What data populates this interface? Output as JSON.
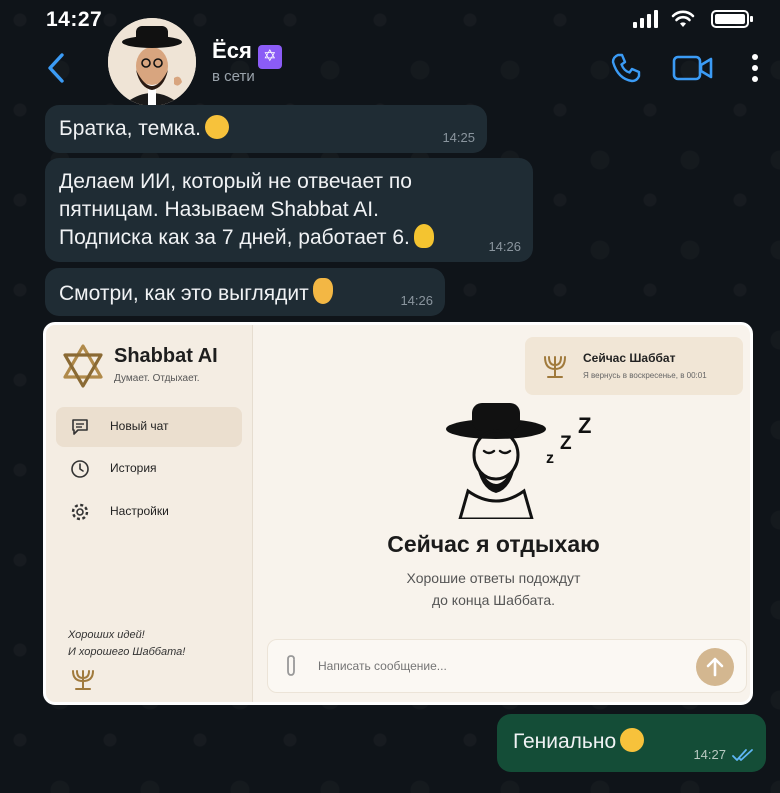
{
  "status_bar": {
    "time": "14:27"
  },
  "header": {
    "contact_name": "Ёся",
    "contact_badge": "✡",
    "contact_status": "в сети"
  },
  "messages": [
    {
      "text": "Братка, темка.",
      "time": "14:25",
      "emoji": "smile"
    },
    {
      "text": "Делаем ИИ, который не отвечает по пятницам. Называем Shabbat AI. Подписка как за 7 дней, работает 6.",
      "time": "14:26",
      "emoji": "light-bulb"
    },
    {
      "text": "Смотри, как это выглядит",
      "time": "14:26",
      "emoji": "pointing-down"
    }
  ],
  "app": {
    "title": "Shabbat AI",
    "subtitle": "Думает. Отдыхает.",
    "nav": [
      {
        "label": "Новый чат",
        "icon": "chat-icon",
        "active": true
      },
      {
        "label": "История",
        "icon": "clock-icon",
        "active": false
      },
      {
        "label": "Настройки",
        "icon": "gear-icon",
        "active": false
      }
    ],
    "side_note_line1": "Хороших идей!",
    "side_note_line2": "И хорошего Шаббата!",
    "status_title": "Сейчас Шаббат",
    "status_sub": "Я вернусь в воскресенье, в 00:01",
    "rest_title": "Сейчас я отдыхаю",
    "rest_sub_line1": "Хорошие ответы подождут",
    "rest_sub_line2": "до конца Шаббата.",
    "composer_placeholder": "Написать сообщение..."
  },
  "reply": {
    "text": "Гениально",
    "time": "14:27",
    "emoji": "laughing"
  },
  "colors": {
    "incoming_bubble": "#1f2c34",
    "outgoing_bubble": "#144d37",
    "accent_blue": "#3b9bf5",
    "gold": "#b08a4a"
  }
}
